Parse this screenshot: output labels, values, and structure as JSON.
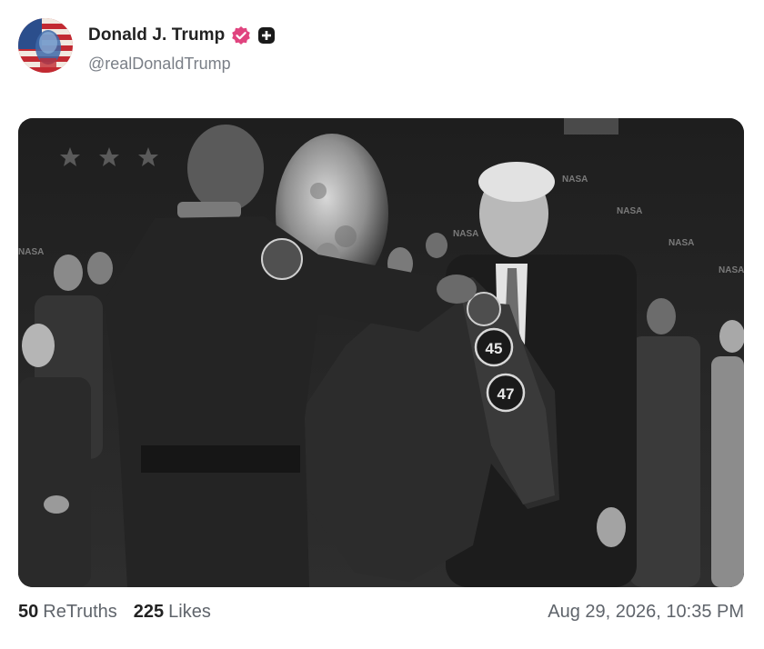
{
  "post": {
    "author_name": "Donald J. Trump",
    "author_handle": "@realDonaldTrump",
    "verified_icon": "verified-badge-icon",
    "plus_icon": "plus-badge-icon",
    "image_alt": "photo",
    "retruths_count": "50",
    "retruths_label": "ReTruths",
    "likes_count": "225",
    "likes_label": "Likes",
    "timestamp": "Aug 29, 2026, 10:35 PM"
  },
  "photo_text": {
    "patch_1": "45",
    "patch_2": "47"
  },
  "colors": {
    "verified_pink": "#e0447f",
    "text_dark": "#222222",
    "text_muted": "#5f646b",
    "handle_gray": "#7a7f87"
  }
}
